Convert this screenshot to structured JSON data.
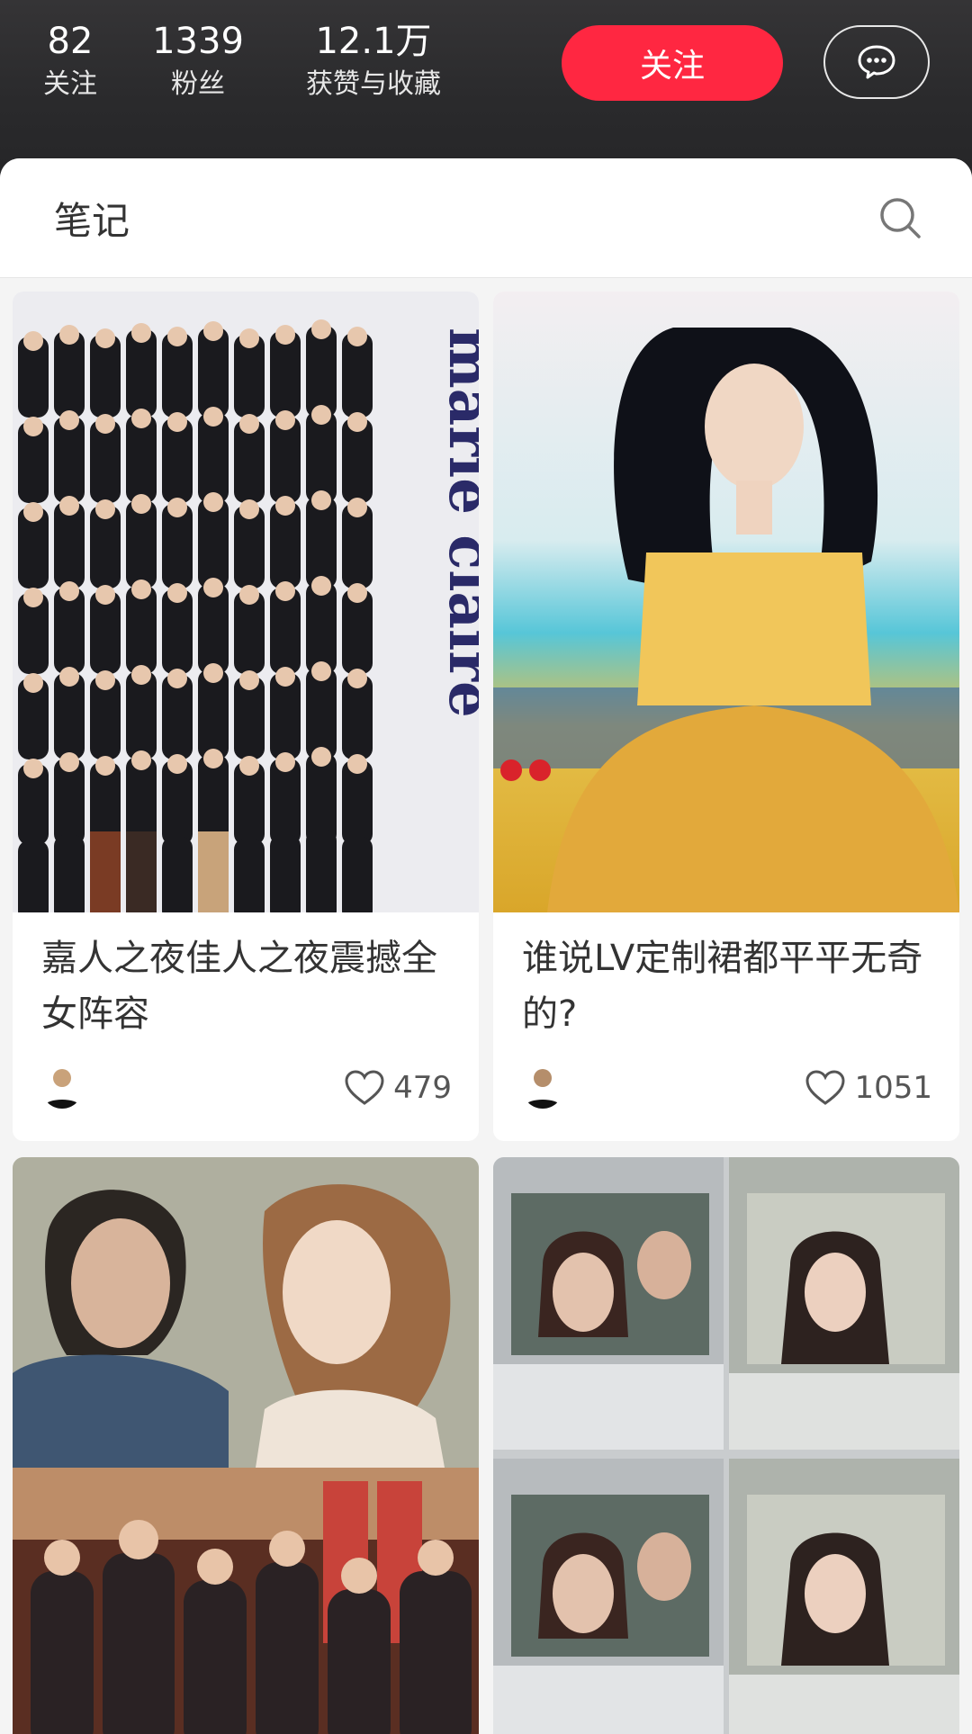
{
  "profile": {
    "stats": [
      {
        "value": "82",
        "label": "关注"
      },
      {
        "value": "1339",
        "label": "粉丝"
      },
      {
        "value": "12.1万",
        "label": "获赞与收藏"
      }
    ],
    "follow_label": "关注",
    "message_icon": "chat-bubble-icon"
  },
  "tabs": {
    "notes_label": "笔记",
    "search_icon": "search-icon"
  },
  "notes": [
    {
      "title": "嘉人之夜佳人之夜震撼全女阵容",
      "likes": "479",
      "cover_text": "marie claire"
    },
    {
      "title": "谁说LV定制裙都平平无奇的?",
      "likes": "1051"
    },
    {
      "title": ""
    },
    {
      "title": ""
    }
  ],
  "colors": {
    "accent": "#ff2741",
    "header_bg": "#2b2b2d",
    "feed_bg": "#f4f4f4"
  }
}
